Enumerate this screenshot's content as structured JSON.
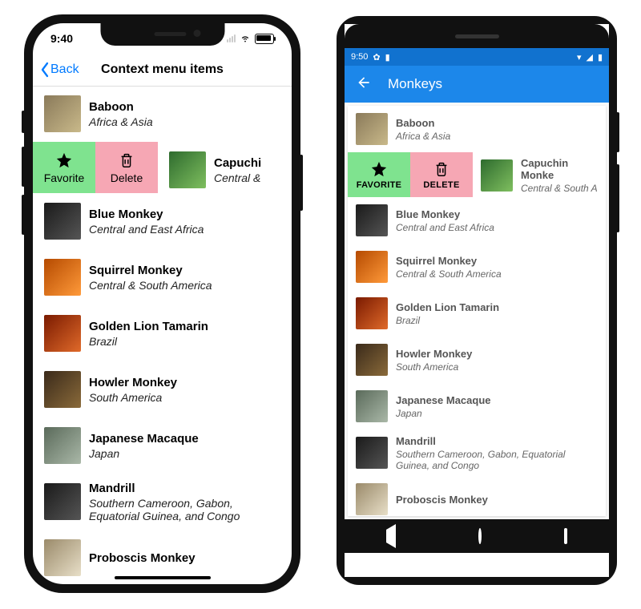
{
  "ios": {
    "status_time": "9:40",
    "back_label": "Back",
    "title": "Context menu items"
  },
  "android": {
    "status_time": "9:50",
    "title": "Monkeys"
  },
  "swipe": {
    "favorite_label_ios": "Favorite",
    "delete_label_ios": "Delete",
    "favorite_label_and": "FAVORITE",
    "delete_label_and": "DELETE"
  },
  "monkeys": [
    {
      "name": "Baboon",
      "loc": "Africa & Asia",
      "cls": "ph"
    },
    {
      "name": "Capuchin Monkey",
      "loc": "Central & South America",
      "cls": "ph green",
      "swiped": true,
      "name_ios": "Capuchi",
      "loc_ios": "Central &",
      "name_and": "Capuchin Monke",
      "loc_and": "Central & South A"
    },
    {
      "name": "Blue Monkey",
      "loc": "Central and East Africa",
      "cls": "ph dark"
    },
    {
      "name": "Squirrel Monkey",
      "loc": "Central & South America",
      "cls": "ph orange"
    },
    {
      "name": "Golden Lion Tamarin",
      "loc": "Brazil",
      "cls": "ph red"
    },
    {
      "name": "Howler Monkey",
      "loc": "South America",
      "cls": "ph brown"
    },
    {
      "name": "Japanese Macaque",
      "loc": "Japan",
      "cls": "ph gray"
    },
    {
      "name": "Mandrill",
      "loc": "Southern Cameroon, Gabon, Equatorial Guinea, and Congo",
      "cls": "ph dark"
    },
    {
      "name": "Proboscis Monkey",
      "loc": "",
      "cls": "ph white"
    }
  ]
}
